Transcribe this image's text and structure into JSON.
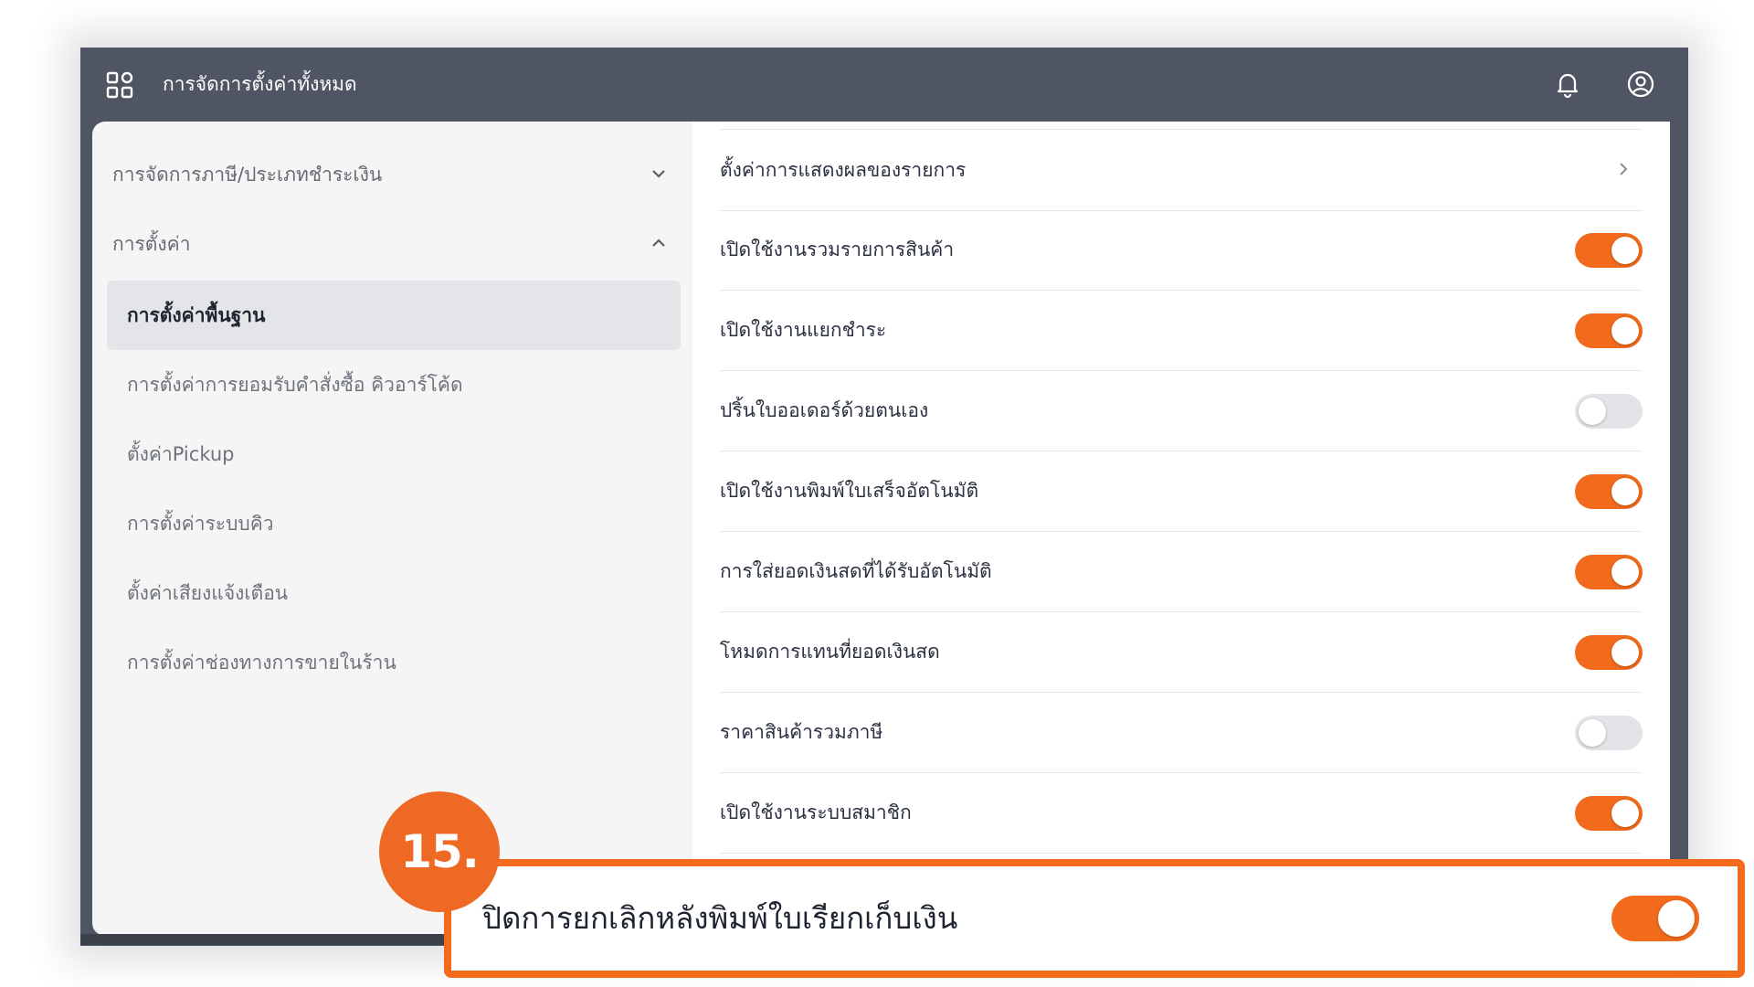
{
  "topbar": {
    "title": "การจัดการตั้งค่าทั้งหมด",
    "icons": [
      "apps-grid-icon",
      "bell-icon",
      "user-circle-icon"
    ]
  },
  "sidebar": {
    "groups": [
      {
        "label": "การจัดการภาษี/ประเภทชำระเงิน",
        "expanded": false
      },
      {
        "label": "การตั้งค่า",
        "expanded": true
      }
    ],
    "items": [
      {
        "label": "การตั้งค่าพื้นฐาน",
        "active": true
      },
      {
        "label": "การตั้งค่าการยอมรับคำสั่งซื้อ คิวอาร์โค้ด",
        "active": false
      },
      {
        "label": "ตั้งค่าPickup",
        "active": false
      },
      {
        "label": "การตั้งค่าระบบคิว",
        "active": false
      },
      {
        "label": "ตั้งค่าเสียงแจ้งเตือน",
        "active": false
      },
      {
        "label": "การตั้งค่าช่องทางการขายในร้าน",
        "active": false
      }
    ]
  },
  "settings": [
    {
      "label": "ตั้งค่าการแสดงผลของรายการ",
      "type": "link"
    },
    {
      "label": "เปิดใช้งานรวมรายการสินค้า",
      "type": "toggle",
      "on": true
    },
    {
      "label": "เปิดใช้งานแยกชำระ",
      "type": "toggle",
      "on": true
    },
    {
      "label": "ปริ้นใบออเดอร์ด้วยตนเอง",
      "type": "toggle",
      "on": false
    },
    {
      "label": "เปิดใช้งานพิมพ์ใบเสร็จอัตโนมัติ",
      "type": "toggle",
      "on": true
    },
    {
      "label": "การใส่ยอดเงินสดที่ได้รับอัตโนมัติ",
      "type": "toggle",
      "on": true
    },
    {
      "label": "โหมดการแทนที่ยอดเงินสด",
      "type": "toggle",
      "on": true
    },
    {
      "label": "ราคาสินค้ารวมภาษี",
      "type": "toggle",
      "on": false
    },
    {
      "label": "เปิดใช้งานระบบสมาชิก",
      "type": "toggle",
      "on": true
    }
  ],
  "highlight": {
    "step": "15.",
    "label": "ปิดการยกเลิกหลังพิมพ์ใบเรียกเก็บเงิน",
    "on": true
  },
  "colors": {
    "accent": "#f26a1b",
    "topbar": "#4f5563",
    "toggle_off": "#e3e4e7"
  }
}
